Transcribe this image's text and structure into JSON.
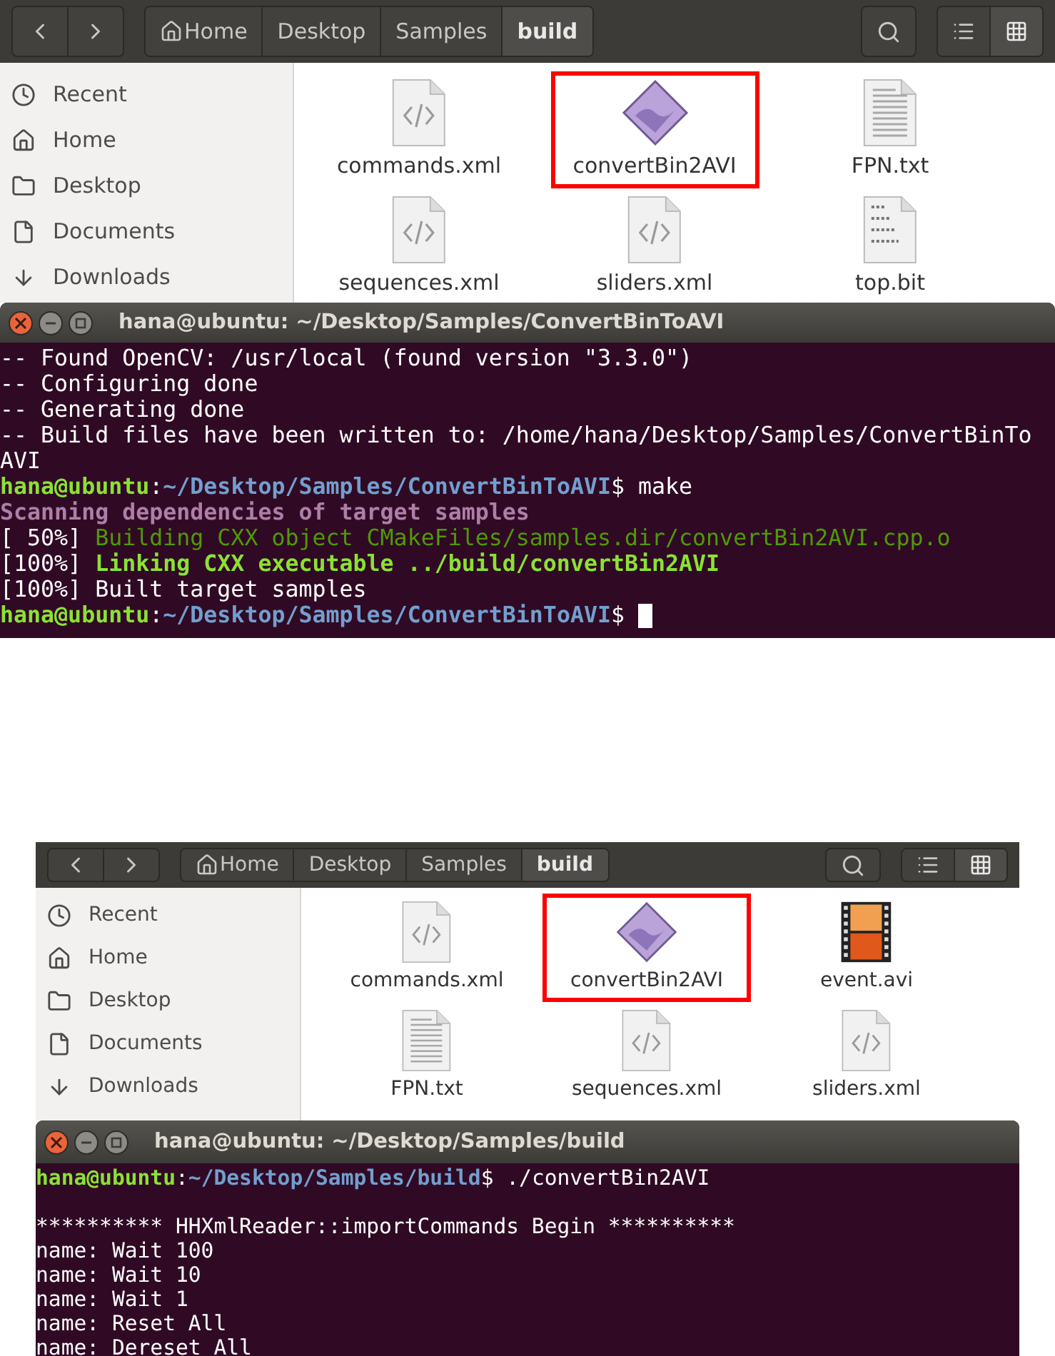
{
  "screenshots": [
    {
      "file_manager": {
        "breadcrumbs": [
          {
            "label": "Home",
            "kind": "home",
            "selected": false
          },
          {
            "label": "Desktop",
            "kind": "folder",
            "selected": false
          },
          {
            "label": "Samples",
            "kind": "folder",
            "selected": false
          },
          {
            "label": "build",
            "kind": "folder",
            "selected": true
          }
        ],
        "view_buttons": [
          {
            "kind": "list",
            "selected": false
          },
          {
            "kind": "grid",
            "selected": true
          }
        ],
        "sidebar": [
          {
            "label": "Recent",
            "kind": "recent"
          },
          {
            "label": "Home",
            "kind": "home"
          },
          {
            "label": "Desktop",
            "kind": "desktop"
          },
          {
            "label": "Documents",
            "kind": "documents"
          },
          {
            "label": "Downloads",
            "kind": "downloads"
          }
        ],
        "files": [
          {
            "name": "commands.xml",
            "kind": "xml",
            "highlighted": false
          },
          {
            "name": "convertBin2AVI",
            "kind": "executable",
            "highlighted": true
          },
          {
            "name": "FPN.txt",
            "kind": "text",
            "highlighted": false
          },
          {
            "name": "sequences.xml",
            "kind": "xml",
            "highlighted": false
          },
          {
            "name": "sliders.xml",
            "kind": "xml",
            "highlighted": false
          },
          {
            "name": "top.bit",
            "kind": "binary",
            "highlighted": false
          }
        ]
      },
      "terminal": {
        "title": "hana@ubuntu: ~/Desktop/Samples/ConvertBinToAVI",
        "lines": [
          {
            "segments": [
              {
                "text": "-- Found OpenCV: /usr/local (found version \"3.3.0\")",
                "kind": "plain"
              }
            ]
          },
          {
            "segments": [
              {
                "text": "-- Configuring done",
                "kind": "plain"
              }
            ]
          },
          {
            "segments": [
              {
                "text": "-- Generating done",
                "kind": "plain"
              }
            ]
          },
          {
            "segments": [
              {
                "text": "-- Build files have been written to: /home/hana/Desktop/Samples/ConvertBinTo",
                "kind": "plain"
              }
            ]
          },
          {
            "segments": [
              {
                "text": "AVI",
                "kind": "plain"
              }
            ]
          },
          {
            "segments": [
              {
                "text": "hana@ubuntu",
                "kind": "user"
              },
              {
                "text": ":",
                "kind": "plain"
              },
              {
                "text": "~/Desktop/Samples/ConvertBinToAVI",
                "kind": "path"
              },
              {
                "text": "$ make",
                "kind": "plain"
              }
            ]
          },
          {
            "segments": [
              {
                "text": "Scanning dependencies of target samples",
                "kind": "scan"
              }
            ]
          },
          {
            "segments": [
              {
                "text": "[ 50%] ",
                "kind": "plain"
              },
              {
                "text": "Building CXX object CMakeFiles/samples.dir/convertBin2AVI.cpp.o",
                "kind": "green"
              }
            ]
          },
          {
            "segments": [
              {
                "text": "[100%] ",
                "kind": "plain"
              },
              {
                "text": "Linking CXX executable ../build/convertBin2AVI",
                "kind": "greenbold"
              }
            ]
          },
          {
            "segments": [
              {
                "text": "[100%] Built target samples",
                "kind": "plain"
              }
            ]
          },
          {
            "segments": [
              {
                "text": "hana@ubuntu",
                "kind": "user"
              },
              {
                "text": ":",
                "kind": "plain"
              },
              {
                "text": "~/Desktop/Samples/ConvertBinToAVI",
                "kind": "path"
              },
              {
                "text": "$ ",
                "kind": "plain"
              }
            ],
            "cursor": true
          }
        ]
      }
    },
    {
      "file_manager": {
        "breadcrumbs": [
          {
            "label": "Home",
            "kind": "home",
            "selected": false
          },
          {
            "label": "Desktop",
            "kind": "folder",
            "selected": false
          },
          {
            "label": "Samples",
            "kind": "folder",
            "selected": false
          },
          {
            "label": "build",
            "kind": "folder",
            "selected": true
          }
        ],
        "view_buttons": [
          {
            "kind": "list",
            "selected": false
          },
          {
            "kind": "grid",
            "selected": true
          }
        ],
        "sidebar": [
          {
            "label": "Recent",
            "kind": "recent"
          },
          {
            "label": "Home",
            "kind": "home"
          },
          {
            "label": "Desktop",
            "kind": "desktop"
          },
          {
            "label": "Documents",
            "kind": "documents"
          },
          {
            "label": "Downloads",
            "kind": "downloads"
          }
        ],
        "files": [
          {
            "name": "commands.xml",
            "kind": "xml",
            "highlighted": false
          },
          {
            "name": "convertBin2AVI",
            "kind": "executable",
            "highlighted": true
          },
          {
            "name": "event.avi",
            "kind": "video",
            "highlighted": false
          },
          {
            "name": "FPN.txt",
            "kind": "text",
            "highlighted": false
          },
          {
            "name": "sequences.xml",
            "kind": "xml",
            "highlighted": false
          },
          {
            "name": "sliders.xml",
            "kind": "xml",
            "highlighted": false
          }
        ]
      },
      "terminal": {
        "title": "hana@ubuntu: ~/Desktop/Samples/build",
        "lines": [
          {
            "segments": [
              {
                "text": "hana@ubuntu",
                "kind": "user"
              },
              {
                "text": ":",
                "kind": "plain"
              },
              {
                "text": "~/Desktop/Samples/build",
                "kind": "path"
              },
              {
                "text": "$ ./convertBin2AVI",
                "kind": "plain"
              }
            ]
          },
          {
            "segments": [
              {
                "text": "********** HHXmlReader::importCommands Begin **********",
                "kind": "plain"
              }
            ],
            "blank_before": true
          },
          {
            "segments": [
              {
                "text": "name: Wait 100",
                "kind": "plain"
              }
            ]
          },
          {
            "segments": [
              {
                "text": "name: Wait 10",
                "kind": "plain"
              }
            ]
          },
          {
            "segments": [
              {
                "text": "name: Wait 1",
                "kind": "plain"
              }
            ]
          },
          {
            "segments": [
              {
                "text": "name: Reset All",
                "kind": "plain"
              }
            ]
          },
          {
            "segments": [
              {
                "text": "name: Dereset All",
                "kind": "plain"
              }
            ]
          }
        ]
      }
    }
  ]
}
